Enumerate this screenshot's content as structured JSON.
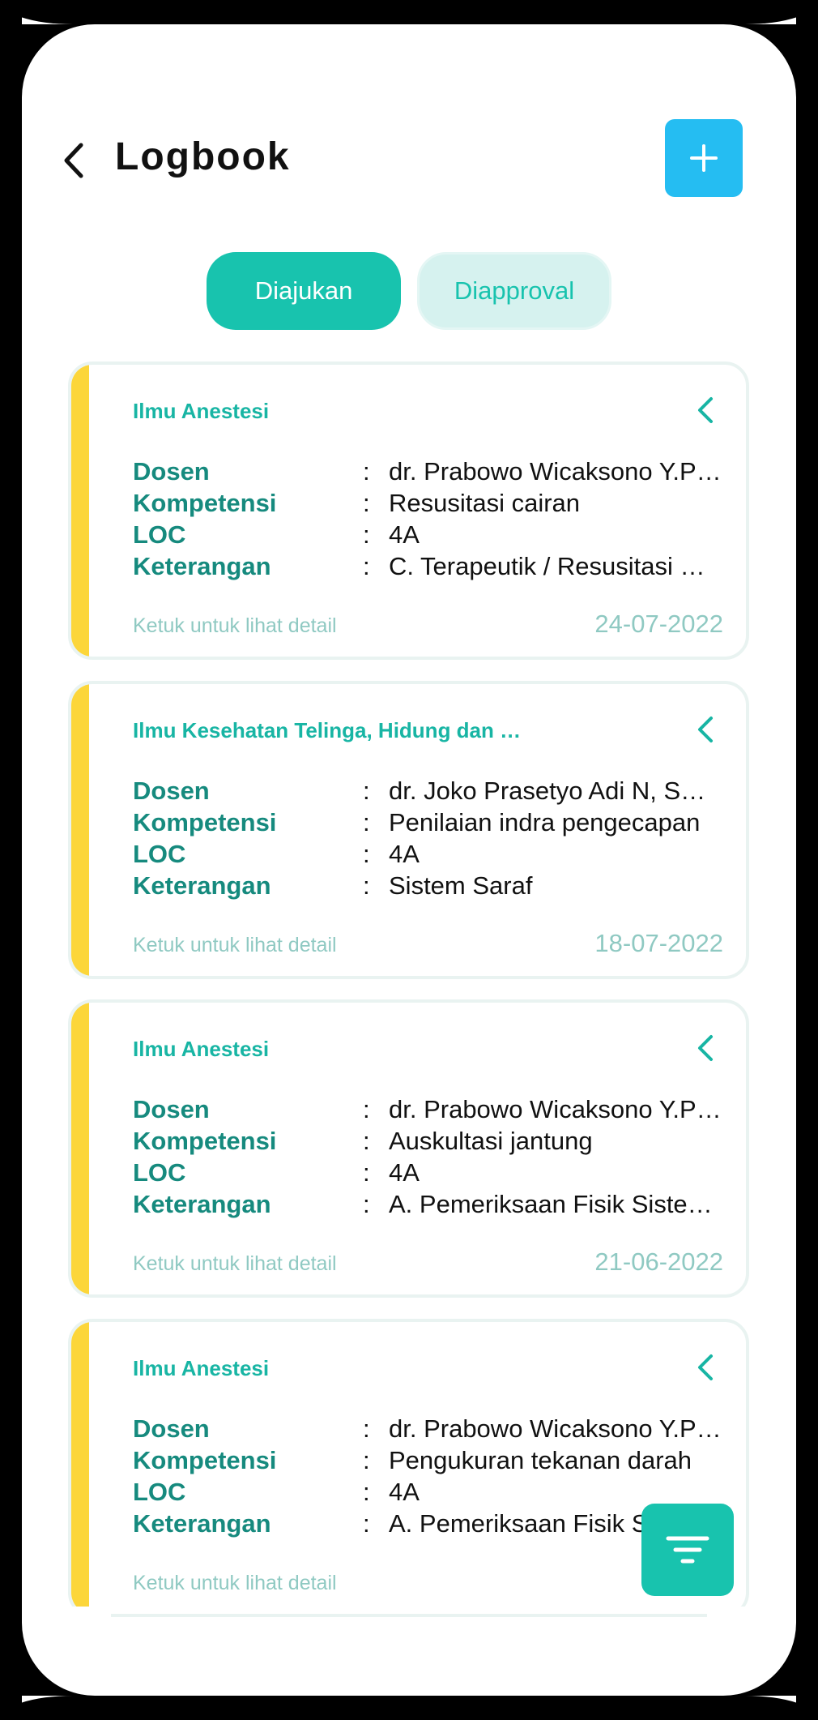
{
  "header": {
    "title": "Logbook"
  },
  "tabs": [
    {
      "label": "Diajukan",
      "active": true
    },
    {
      "label": "Diapproval",
      "active": false
    }
  ],
  "labels": {
    "dosen": "Dosen",
    "kompetensi": "Kompetensi",
    "loc": "LOC",
    "keterangan": "Keterangan",
    "colon": ":",
    "hint": "Ketuk untuk lihat detail"
  },
  "cards": [
    {
      "subject": "Ilmu Anestesi",
      "dosen": "dr. Prabowo Wicaksono Y.P…",
      "kompetensi": "Resusitasi cairan",
      "loc": "4A",
      "keterangan": "C. Terapeutik / Resusitasi …",
      "date": "24-07-2022"
    },
    {
      "subject": "Ilmu Kesehatan Telinga, Hidung dan …",
      "dosen": "dr. Joko Prasetyo Adi N, S…",
      "kompetensi": "Penilaian indra pengecapan",
      "loc": "4A",
      "keterangan": "Sistem Saraf",
      "date": "18-07-2022"
    },
    {
      "subject": "Ilmu Anestesi",
      "dosen": "dr. Prabowo Wicaksono Y.P…",
      "kompetensi": "Auskultasi jantung",
      "loc": "4A",
      "keterangan": "A. Pemeriksaan Fisik Siste…",
      "date": "21-06-2022"
    },
    {
      "subject": "Ilmu Anestesi",
      "dosen": "dr. Prabowo Wicaksono Y.P…",
      "kompetensi": "Pengukuran tekanan darah",
      "loc": "4A",
      "keterangan": "A. Pemeriksaan Fisik Si",
      "date": "20-0"
    }
  ],
  "colors": {
    "accent": "#18c3ae",
    "add_button": "#25bdf2",
    "card_bar": "#fcd63a",
    "label": "#168a7e"
  },
  "icons": {
    "back": "chevron-left-icon",
    "add": "plus-icon",
    "card_toggle": "chevron-left-icon",
    "filter": "filter-icon"
  }
}
